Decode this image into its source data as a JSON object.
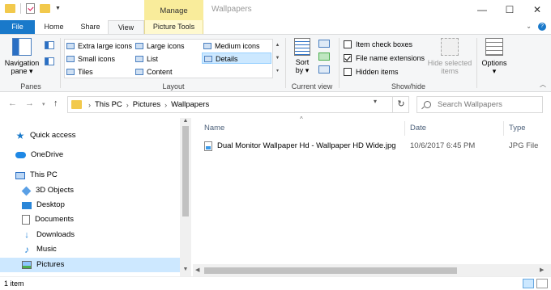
{
  "window": {
    "title": "Wallpapers",
    "contextual_group": "Manage",
    "minimize": "—",
    "maximize": "☐",
    "close": "✕"
  },
  "ribbon_tabs": {
    "file": "File",
    "home": "Home",
    "share": "Share",
    "view": "View",
    "picture_tools": "Picture Tools",
    "expand": "⌄",
    "help": "?"
  },
  "ribbon": {
    "panes": {
      "navigation_pane_line1": "Navigation",
      "navigation_pane_line2": "pane ▾",
      "label": "Panes"
    },
    "layout": {
      "items": [
        "Extra large icons",
        "Large icons",
        "Medium icons",
        "Small icons",
        "List",
        "Details",
        "Tiles",
        "Content"
      ],
      "selected": "Details",
      "label": "Layout"
    },
    "current_view": {
      "sort_line1": "Sort",
      "sort_line2": "by ▾",
      "label": "Current view"
    },
    "show_hide": {
      "item_check_boxes": "Item check boxes",
      "file_name_extensions": "File name extensions",
      "hidden_items": "Hidden items",
      "item_check_boxes_checked": false,
      "file_name_extensions_checked": true,
      "hidden_items_checked": false,
      "hide_selected_line1": "Hide selected",
      "hide_selected_line2": "items",
      "label": "Show/hide"
    },
    "options": {
      "label": "Options",
      "arrow": "▾"
    }
  },
  "address_bar": {
    "crumbs": [
      "This PC",
      "Pictures",
      "Wallpapers"
    ],
    "separator": "›",
    "refresh": "↻",
    "search_placeholder": "Search Wallpapers"
  },
  "nav_pane": {
    "items": [
      {
        "label": "Quick access",
        "icon": "star-icon"
      },
      {
        "label": "OneDrive",
        "icon": "cloud-icon"
      },
      {
        "label": "This PC",
        "icon": "pc-icon"
      },
      {
        "label": "3D Objects",
        "icon": "3d-objects-icon"
      },
      {
        "label": "Desktop",
        "icon": "desktop-icon"
      },
      {
        "label": "Documents",
        "icon": "documents-icon"
      },
      {
        "label": "Downloads",
        "icon": "downloads-icon"
      },
      {
        "label": "Music",
        "icon": "music-icon"
      },
      {
        "label": "Pictures",
        "icon": "pictures-icon"
      }
    ],
    "selected": "Pictures"
  },
  "file_list": {
    "columns": [
      "Name",
      "Date",
      "Type"
    ],
    "sort_indicator": "^",
    "rows": [
      {
        "name": "Dual Monitor Wallpaper Hd - Wallpaper HD Wide.jpg",
        "date": "10/6/2017 6:45 PM",
        "type": "JPG File"
      }
    ]
  },
  "status_bar": {
    "item_count": "1 item"
  }
}
